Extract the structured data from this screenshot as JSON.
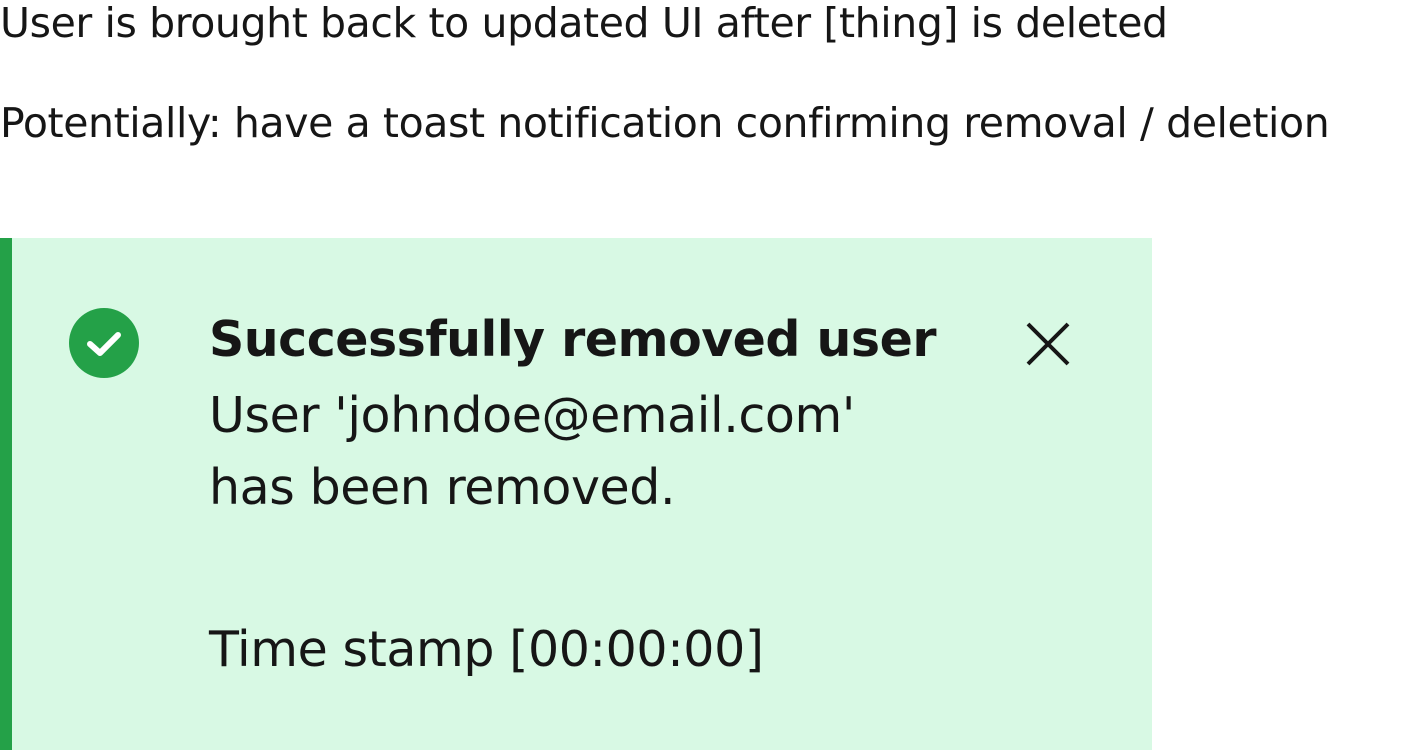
{
  "notes": {
    "line1": "User is brought back to updated UI after [thing] is deleted",
    "line2": "Potentially: have a toast notification confirming removal / deletion"
  },
  "toast": {
    "kind": "success",
    "icon": "checkmark-filled-icon",
    "close_icon": "close-icon",
    "title": "Successfully removed user",
    "body": "User 'johndoe@email.com' has been removed.",
    "timestamp": "Time stamp [00:00:00]",
    "colors": {
      "background": "#d8f9e4",
      "accent": "#24a148",
      "text": "#161616"
    }
  }
}
